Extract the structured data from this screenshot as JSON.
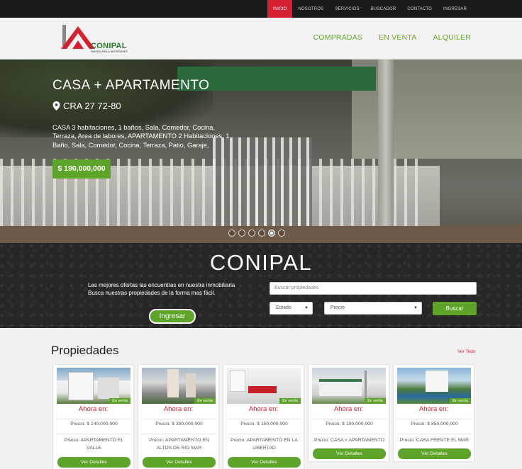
{
  "topnav": [
    {
      "label": "INICIO",
      "active": true
    },
    {
      "label": "NOSOTROS"
    },
    {
      "label": "SERVICIOS"
    },
    {
      "label": "BUSCADOR"
    },
    {
      "label": "CONTACTO"
    },
    {
      "label": "INGRESAR"
    }
  ],
  "logo": {
    "name": "CONIPAL",
    "tagline": "INMOBILIARIA & INVERSIONES"
  },
  "mainnav": [
    "COMPRADAS",
    "EN VENTA",
    "ALQUILER"
  ],
  "hero": {
    "title": "CASA + APARTAMENTO",
    "address": "CRA 27 72-80",
    "description": "CASA 3 habitaciones, 1 baños, Sala, Comedor, Cocina, Terraza, Area de labores, APARTAMENTO 2 Habitaciones, 1 Baño, Sala, Comedor, Cocina, Terraza, Patio, Garaje,",
    "price": "$ 190,000,000",
    "slides": 6,
    "active_slide": 5
  },
  "search": {
    "title": "CONIPAL",
    "text_line1": "Las mejores ofertas las encuentras en nuestra inmobiliaria",
    "text_line2": "Busca nuestras propiedades de la forma mas fácil.",
    "login_button": "Ingresar",
    "placeholder": "Buscar propiedades",
    "estado": "Estado",
    "precio": "Precio",
    "submit": "Buscar"
  },
  "properties": {
    "title": "Propiedades",
    "see_all": "Ver Todo",
    "items": [
      {
        "badge": "En venta",
        "ahora": "Ahora en:",
        "precio": "Precio: $ 140,000,000",
        "nombre": "Precio: APARTAMENTO EL VALLE",
        "button": "Ver Detalles"
      },
      {
        "badge": "En venta",
        "ahora": "Ahora en:",
        "precio": "Precio: $ 380,000,000",
        "nombre": "Precio: APARTAMENTO EN ALTOS DE RIO MAR",
        "button": "Ver Detalles"
      },
      {
        "badge": "En venta",
        "ahora": "Ahora en:",
        "precio": "Precio: $ 150,000,000",
        "nombre": "Precio: APARTAMENTO EN LA LIBERTAD",
        "button": "Ver Detalles"
      },
      {
        "badge": "En venta",
        "ahora": "Ahora en:",
        "precio": "Precio: $ 190,000,000",
        "nombre": "Precio: CASA + APARTAMENTO",
        "button": "Ver Detalles"
      },
      {
        "badge": "En venta",
        "ahora": "Ahora en:",
        "precio": "Precio: $ 850,000,000",
        "nombre": "Precio: CASA FRENTE EL MAR",
        "button": "Ver Detalles"
      }
    ]
  }
}
